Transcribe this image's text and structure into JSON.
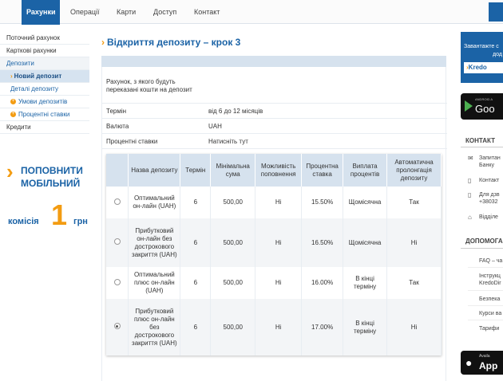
{
  "nav": {
    "tabs": [
      "Рахунки",
      "Операції",
      "Карти",
      "Доступ",
      "Контакт"
    ],
    "active": "Рахунки"
  },
  "sidebar": {
    "items": [
      {
        "label": "Поточний рахунок"
      },
      {
        "label": "Карткові рахунки"
      },
      {
        "label": "Депозити"
      },
      {
        "label": "Новий депозит"
      },
      {
        "label": "Деталі депозиту"
      },
      {
        "label": "Умови депозитів"
      },
      {
        "label": "Процентні ставки"
      },
      {
        "label": "Кредити"
      }
    ]
  },
  "promo": {
    "line1": "ПОПОВНИТИ",
    "line2": "МОБІЛЬНИЙ",
    "fee_label": "комісія",
    "fee_value": "1",
    "fee_currency": "грн"
  },
  "page": {
    "title": "Відкриття депозиту – крок 3"
  },
  "form": {
    "source_label": "Рахунок, з якого будуть переказані кошти на депозит",
    "term_label": "Термін",
    "term_value": "від 6 до 12 місяців",
    "currency_label": "Валюта",
    "currency_value": "UAH",
    "rates_label": "Процентні ставки",
    "rates_value": "Натисніть тут"
  },
  "table": {
    "headers": [
      "",
      "Назва депозиту",
      "Термін",
      "Мінімальна сума",
      "Можливість поповнення",
      "Процентна ставка",
      "Виплата процентів",
      "Автоматична пролонгація депозиту"
    ],
    "rows": [
      {
        "selected": false,
        "name": "Оптимальний он-лайн (UAH)",
        "term": "6",
        "min": "500,00",
        "topup": "Ні",
        "rate": "15.50%",
        "payout": "Щомісячна",
        "auto": "Так"
      },
      {
        "selected": false,
        "name": "Прибутковий он-лайн без дострокового закриття (UAH)",
        "term": "6",
        "min": "500,00",
        "topup": "Ні",
        "rate": "16.50%",
        "payout": "Щомісячна",
        "auto": "Ні"
      },
      {
        "selected": false,
        "name": "Оптимальний плюс он-лайн (UAH)",
        "term": "6",
        "min": "500,00",
        "topup": "Ні",
        "rate": "16.00%",
        "payout": "В кінці терміну",
        "auto": "Так"
      },
      {
        "selected": true,
        "name": "Прибутковий плюс он-лайн без дострокового закриття (UAH)",
        "term": "6",
        "min": "500,00",
        "topup": "Ні",
        "rate": "17.00%",
        "payout": "В кінці терміну",
        "auto": "Ні"
      }
    ]
  },
  "right": {
    "app_banner_text": [
      "Завантажте с",
      "дод"
    ],
    "app_banner_brand": "Kredo",
    "gplay_small": "ANDROID A",
    "gplay_big": "Goo",
    "contact_head": "КОНТАКТ",
    "contact_items": [
      "Запитан",
      "Банку",
      "Контакт",
      "Для дзв",
      "+38032",
      "Відділе"
    ],
    "help_head": "ДОПОМОГА",
    "help_items": [
      "FAQ – ча",
      "Інструкц",
      "KredoDir",
      "Безпека",
      "Курси ва",
      "Тарифи"
    ],
    "appstore_small": "Availa",
    "appstore_big": "App"
  }
}
